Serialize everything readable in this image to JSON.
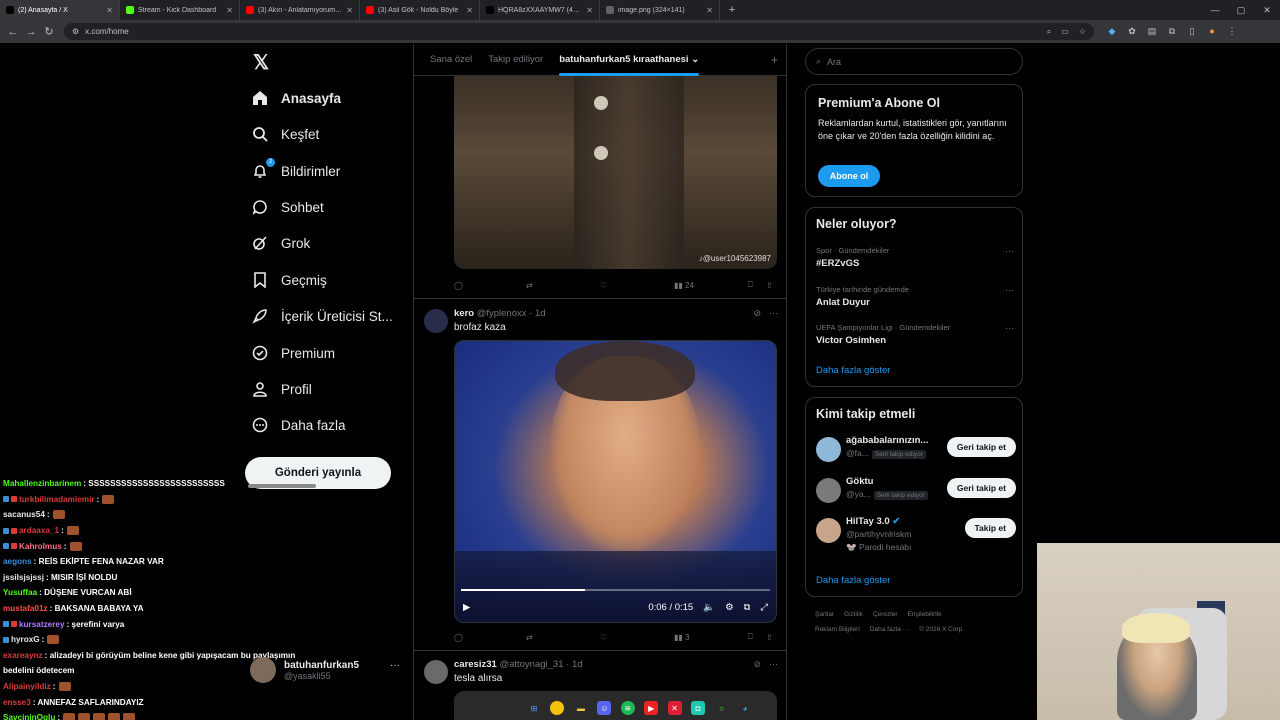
{
  "browser": {
    "tabs": [
      {
        "title": "(2) Anasayfa / X",
        "icon": "x-logo-icon",
        "color": "#000000",
        "active": true
      },
      {
        "title": "Stream - Kick Dashboard",
        "icon": "kick-logo-icon",
        "color": "#53fc18"
      },
      {
        "title": "(3) Akın - Anlatamıyorum - You",
        "icon": "youtube-icon",
        "color": "#ff0000"
      },
      {
        "title": "(3) Asil Gök - Noldu Böyle",
        "icon": "youtube-icon",
        "color": "#ff0000"
      },
      {
        "title": "HQRA8zXXAAYMW7 (458×587)",
        "icon": "x-logo-icon",
        "color": "#000000"
      },
      {
        "title": "image.png (324×141)",
        "icon": "globe-icon",
        "color": "#5f6368"
      }
    ],
    "url": "x.com/home"
  },
  "sidebar": {
    "items": [
      {
        "label": "Anasayfa",
        "icon": "home-icon"
      },
      {
        "label": "Keşfet",
        "icon": "search-icon"
      },
      {
        "label": "Bildirimler",
        "icon": "bell-icon",
        "badge": "2"
      },
      {
        "label": "Sohbet",
        "icon": "chat-icon"
      },
      {
        "label": "Grok",
        "icon": "grok-icon"
      },
      {
        "label": "Geçmiş",
        "icon": "bookmark-icon"
      },
      {
        "label": "İçerik Üreticisi St...",
        "icon": "rocket-icon"
      },
      {
        "label": "Premium",
        "icon": "premium-icon"
      },
      {
        "label": "Profil",
        "icon": "person-icon"
      },
      {
        "label": "Daha fazla",
        "icon": "more-circle-icon"
      }
    ],
    "post_button": "Gönderi yayınla",
    "account": {
      "name": "batuhanfurkan5",
      "handle": "@yasakli55"
    }
  },
  "chat": {
    "lines": [
      {
        "user": "Mahallenzinbarinem",
        "text": ": SSSSSSSSSSSSSSSSSSSSSSSSS",
        "color": "#53fc18",
        "badges": 0,
        "emotes": 0
      },
      {
        "user": "turkbilimadamiemir",
        "text": ":",
        "color": "#d83c3c",
        "badges": 2,
        "emotes": 1
      },
      {
        "user": "sacanus54",
        "text": ":",
        "color": "#e7e9ea",
        "badges": 0,
        "emotes": 1
      },
      {
        "user": "ardaaxa_1",
        "text": ":",
        "color": "#d83c3c",
        "badges": 2,
        "emotes": 1
      },
      {
        "user": "Kahrolmus",
        "text": ":",
        "color": "#ff6e8a",
        "badges": 2,
        "emotes": 1
      },
      {
        "user": "aegons",
        "text": ": REİS EKİPTE FENA NAZAR VAR",
        "color": "#3c8cd8",
        "badges": 0,
        "emotes": 0
      },
      {
        "user": "jssilsjsjssj",
        "text": ": MISIR İŞİ NOLDU",
        "color": "#e7e9ea",
        "badges": 0,
        "emotes": 0
      },
      {
        "user": "Yusuffaa",
        "text": ": DÜŞENE VURCAN ABİ",
        "color": "#53fc18",
        "badges": 0,
        "emotes": 0
      },
      {
        "user": "mustafa01z",
        "text": ": BAKSANA BABAYA YA",
        "color": "#ff4d4d",
        "badges": 0,
        "emotes": 0
      },
      {
        "user": "kursatzerey",
        "text": ": şerefini varya",
        "color": "#b07bff",
        "badges": 2,
        "emotes": 0
      },
      {
        "user": "hyroxG",
        "text": ":",
        "color": "#e7e9ea",
        "badges": 1,
        "emotes": 1
      },
      {
        "user": "exareaynz",
        "text": ": alizadeyi bi görüyüm beline kene gibi yapışacam bu paylaşımın",
        "color": "#d83c3c",
        "badges": 0,
        "emotes": 0
      },
      {
        "user": "",
        "text": "bedelini ödetecem",
        "color": "#e7e9ea",
        "badges": 0,
        "emotes": 0
      },
      {
        "user": "Alipainyildiz",
        "text": ":",
        "color": "#d83c3c",
        "badges": 0,
        "emotes": 1
      },
      {
        "user": "ensse3",
        "text": ": ANNEFAZ SAFLARINDAYIZ",
        "color": "#d83c3c",
        "badges": 0,
        "emotes": 0
      },
      {
        "user": "SavcininOglu",
        "text": ":",
        "color": "#53fc18",
        "badges": 0,
        "emotes": 5
      }
    ]
  },
  "timeline": {
    "tabs": [
      "Sana özel",
      "Takip ediliyor",
      "batuhanfurkan5 kıraathanesi"
    ],
    "post1": {
      "watermark": "♪@user1045623987",
      "views": "24"
    },
    "post2": {
      "name": "kero",
      "handle": "@fyplenoxx",
      "time": "· 1d",
      "text": "brofaz kaza",
      "video_time": "0:06 / 0:15",
      "progress": 0.4,
      "views": "3"
    },
    "post3": {
      "name": "caresiz31",
      "handle": "@attoynagi_31",
      "time": "· 1d",
      "text": "tesla alırsa"
    }
  },
  "right": {
    "search_placeholder": "Ara",
    "premium": {
      "title": "Premium'a Abone Ol",
      "text": "Reklamlardan kurtul, istatistikleri gör, yanıtlarını öne çıkar ve 20'den fazla özelliğin kilidini aç.",
      "button": "Abone ol"
    },
    "trends": {
      "title": "Neler oluyor?",
      "items": [
        {
          "category": "Spor · Gündemdekiler",
          "name": "#ERZvGS"
        },
        {
          "category": "Türkiye tarihinde gündemde",
          "name": "Anlat Duyur"
        },
        {
          "category": "UEFA Şampiyonlar Ligi · Gündemdekiler",
          "name": "Victor Osimhen"
        }
      ],
      "more": "Daha fazla göster"
    },
    "wtf": {
      "title": "Kimi takip etmeli",
      "items": [
        {
          "name": "ağababalarınızın...",
          "handle": "@fa...",
          "badge": "Seni takip ediyor",
          "button": "Geri takip et"
        },
        {
          "name": "Göktu",
          "handle": "@ya...",
          "badge": "Seni takip ediyor",
          "button": "Geri takip et"
        },
        {
          "name": "HilTay 3.0",
          "handle": "@partihyvnlriskm",
          "sub": "🐭 Parodi hesabı",
          "button": "Takip et"
        }
      ],
      "more": "Daha fazla göster"
    },
    "footer": {
      "line1": [
        "Şartlar",
        "Gizlilik",
        "Çerezler",
        "Erişilebilirlik"
      ],
      "line2": [
        "Reklam Bilgileri",
        "Daha fazla ···",
        "© 2026 X Corp."
      ]
    }
  }
}
